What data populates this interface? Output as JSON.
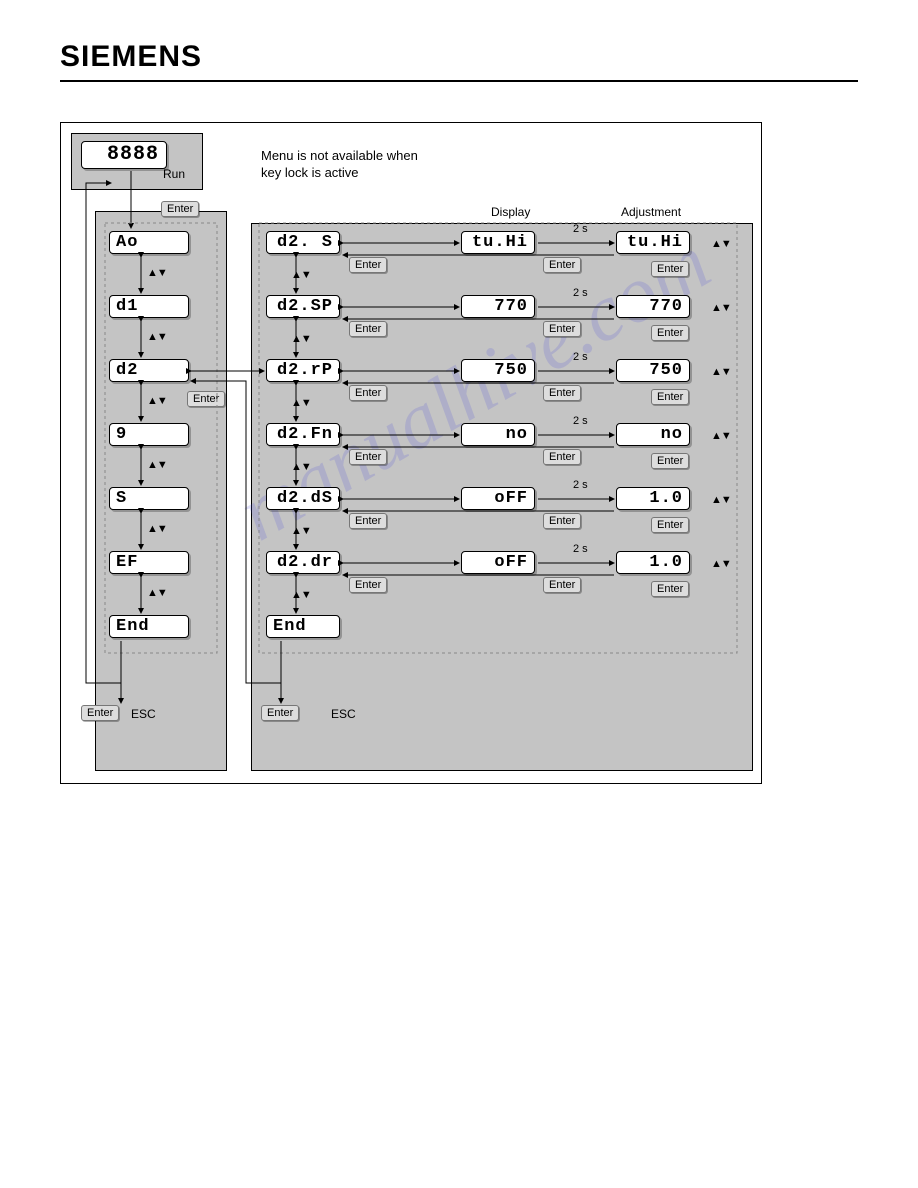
{
  "brand": "SIEMENS",
  "note": "Menu is not available when key lock is active",
  "labels": {
    "run": "Run",
    "enter": "Enter",
    "esc": "ESC",
    "display": "Display",
    "adjustment": "Adjustment",
    "twoSec": "2 s",
    "updown": "▲▼"
  },
  "top_lcd": "8888",
  "left_menu": [
    "Ao",
    "d1",
    "d2",
    "9",
    "S",
    "EF",
    "End"
  ],
  "right_rows": [
    {
      "param": "d2. S",
      "display": "tu.Hi",
      "adjust": "tu.Hi"
    },
    {
      "param": "d2.SP",
      "display": "770",
      "adjust": "770"
    },
    {
      "param": "d2.rP",
      "display": "750",
      "adjust": "750"
    },
    {
      "param": "d2.Fn",
      "display": "no",
      "adjust": "no"
    },
    {
      "param": "d2.dS",
      "display": "oFF",
      "adjust": "1.0"
    },
    {
      "param": "d2.dr",
      "display": "oFF",
      "adjust": "1.0"
    }
  ],
  "right_end": "End",
  "watermark": "manualhive.com"
}
